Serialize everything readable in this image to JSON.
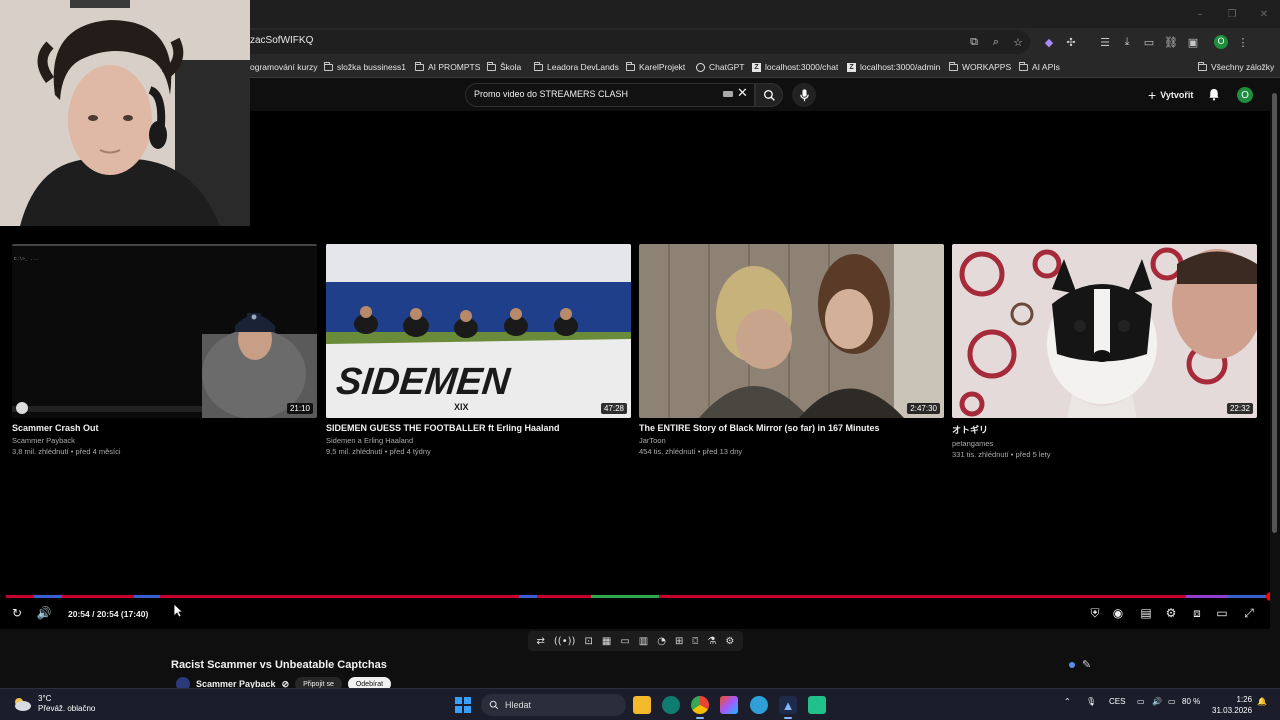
{
  "browser": {
    "url_fragment": "zacSofWIFKQ",
    "bookmarks": [
      {
        "label": "ogramování kurzy",
        "icon": "none"
      },
      {
        "label": "složka bussiness1",
        "icon": "folder-icon"
      },
      {
        "label": "AI PROMPTS",
        "icon": "folder-icon"
      },
      {
        "label": "Škola",
        "icon": "folder-icon"
      },
      {
        "label": "Leadora DevLands",
        "icon": "folder-icon"
      },
      {
        "label": "KarelProjekt",
        "icon": "folder-icon"
      },
      {
        "label": "ChatGPT",
        "icon": "chatgpt-icon"
      },
      {
        "label": "localhost:3000/chat",
        "icon": "z-icon"
      },
      {
        "label": "localhost:3000/admin",
        "icon": "z-icon"
      },
      {
        "label": "WORKAPPS",
        "icon": "folder-icon"
      },
      {
        "label": "AI APIs",
        "icon": "folder-icon"
      }
    ],
    "all_bookmarks_label": "Všechny záložky",
    "profile_initial": "O"
  },
  "youtube": {
    "search_value": "Promo video do STREAMERS CLASH",
    "create_label": "Vytvořit",
    "avatar_initial": "O"
  },
  "endscreen": [
    {
      "title": "Scammer Crash Out",
      "channel": "Scammer Payback",
      "meta": "3,8 mil. zhlédnutí • před 4 měsíci",
      "duration": "21:10"
    },
    {
      "title": "SIDEMEN GUESS THE FOOTBALLER ft Erling Haaland",
      "channel": "Sidemen a Erling Haaland",
      "meta": "9,5 mil. zhlédnutí • před 4 týdny",
      "duration": "47:28"
    },
    {
      "title": "The ENTIRE Story of Black Mirror (so far) in 167 Minutes",
      "channel": "JarToon",
      "meta": "454 tis. zhlédnutí • před 13 dny",
      "duration": "2:47:30"
    },
    {
      "title": "オトギリ",
      "channel": "petangames",
      "meta": "331 tis. zhlédnutí • před 5 lety",
      "duration": "22:32"
    }
  ],
  "player": {
    "time": "20:54 / 20:54 (17:40)",
    "progress_fraction": 1.0
  },
  "video": {
    "title": "Racist Scammer vs Unbeatable Captchas",
    "channel": "Scammer Payback",
    "verified": "⊘",
    "pill_1": "Připojit se",
    "pill_2": "Odebírat"
  },
  "taskbar": {
    "weather_temp": "3°C",
    "weather_desc": "Převáž. oblačno",
    "search_label": "Hledat",
    "lang": "CES",
    "battery": "80 %",
    "time": "1:26",
    "date": "31.03.2026"
  },
  "colors": {
    "progress": "#c4002b",
    "accent_green": "#1e8e3e",
    "windows_blue": "#3aa0ff"
  }
}
